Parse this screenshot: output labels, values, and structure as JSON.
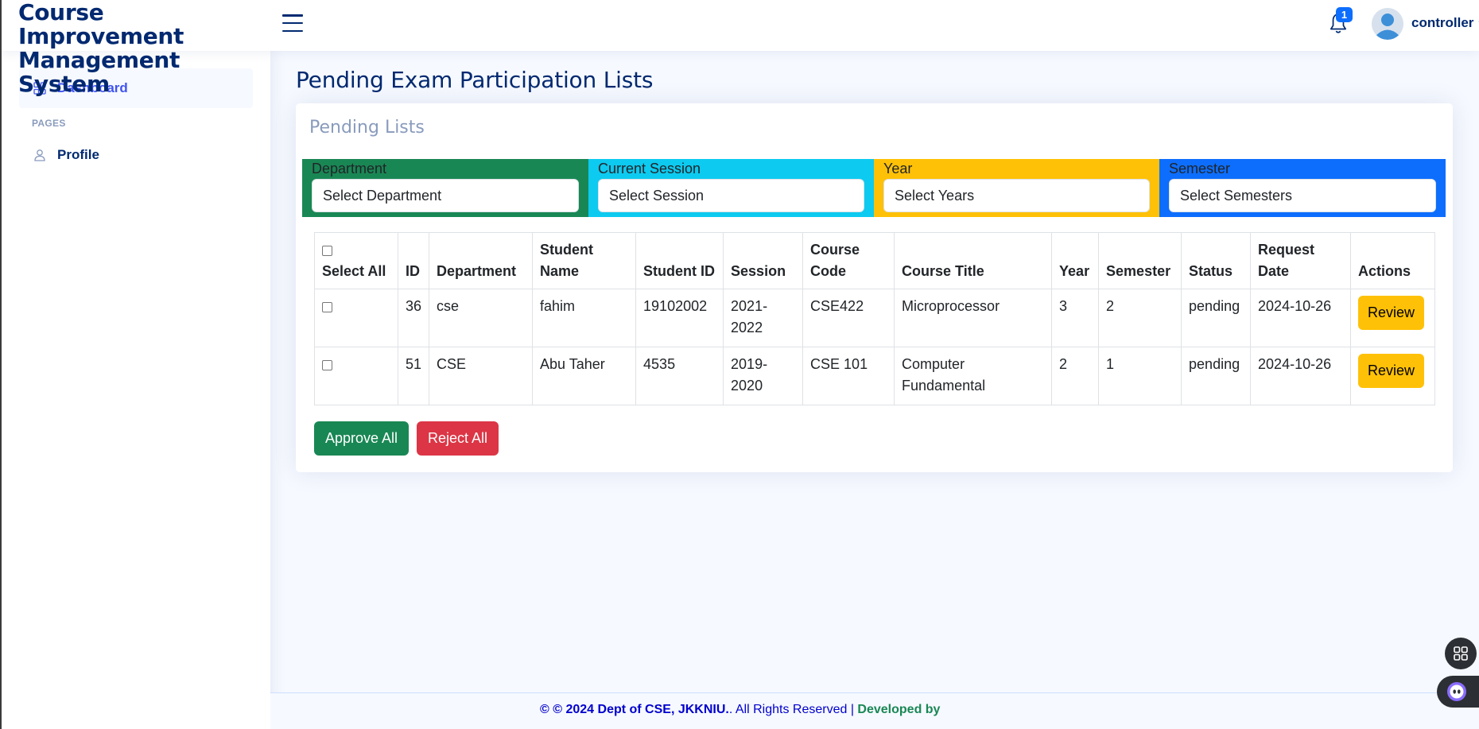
{
  "header": {
    "brand_line1": "Course Improvement",
    "brand_line2": "Management System",
    "notification_count": "1",
    "user_name": "controller"
  },
  "sidebar": {
    "items": [
      {
        "label": "Dashboard",
        "icon": "grid-icon",
        "active": true
      },
      {
        "label": "Profile",
        "icon": "person-icon",
        "active": false
      }
    ],
    "heading": "PAGES"
  },
  "main": {
    "page_title": "Pending Exam Participation Lists",
    "card_title": "Pending Lists",
    "filters": [
      {
        "label": "Department",
        "value": "Select Department",
        "color": "#198754"
      },
      {
        "label": "Current Session",
        "value": "Select Session",
        "color": "#0dcaf0"
      },
      {
        "label": "Year",
        "value": "Select Years",
        "color": "#ffc107"
      },
      {
        "label": "Semester",
        "value": "Select Semesters",
        "color": "#0d6efd"
      }
    ],
    "table": {
      "columns": [
        "Select All",
        "ID",
        "Department",
        "Student Name",
        "Student ID",
        "Session",
        "Course Code",
        "Course Title",
        "Year",
        "Semester",
        "Status",
        "Request Date",
        "Actions"
      ],
      "rows": [
        {
          "id": "36",
          "department": "cse",
          "student_name": "fahim",
          "student_id": "19102002",
          "session": "2021-2022",
          "course_code": "CSE422",
          "course_title": "Microprocessor",
          "year": "3",
          "semester": "2",
          "status": "pending",
          "request_date": "2024-10-26",
          "action": "Review"
        },
        {
          "id": "51",
          "department": "CSE",
          "student_name": "Abu Taher",
          "student_id": "4535",
          "session": "2019-2020",
          "course_code": "CSE 101",
          "course_title": "Computer Fundamental",
          "year": "2",
          "semester": "1",
          "status": "pending",
          "request_date": "2024-10-26",
          "action": "Review"
        }
      ]
    },
    "approve_all": "Approve All",
    "reject_all": "Reject All"
  },
  "footer": {
    "copyright": "© © 2024 Dept of CSE, JKKNIU.",
    "rights": ". All Rights Reserved | ",
    "developed": "Developed by"
  },
  "colors": {
    "brand": "#012970",
    "accent": "#4154f1",
    "success": "#198754",
    "danger": "#dc3545",
    "warning": "#ffc107",
    "info": "#0dcaf0",
    "primary": "#0d6efd"
  }
}
